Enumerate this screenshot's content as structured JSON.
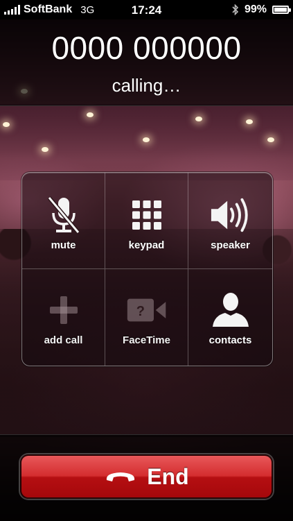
{
  "status_bar": {
    "carrier": "SoftBank",
    "network": "3G",
    "time": "17:24",
    "battery_percent": "99%",
    "battery_level": 0.99,
    "icons": [
      "signal-icon",
      "bluetooth-icon",
      "battery-icon"
    ]
  },
  "call": {
    "number": "0000 000000",
    "status": "calling…"
  },
  "controls": [
    {
      "label": "mute",
      "icon": "mic-muted-icon",
      "enabled": true
    },
    {
      "label": "keypad",
      "icon": "keypad-icon",
      "enabled": true
    },
    {
      "label": "speaker",
      "icon": "speaker-icon",
      "enabled": true
    },
    {
      "label": "add call",
      "icon": "plus-icon",
      "enabled": false
    },
    {
      "label": "FaceTime",
      "icon": "facetime-icon",
      "enabled": false
    },
    {
      "label": "contacts",
      "icon": "person-icon",
      "enabled": true
    }
  ],
  "end_button": {
    "label": "End",
    "icon": "hangup-icon",
    "color": "#c9191c"
  }
}
